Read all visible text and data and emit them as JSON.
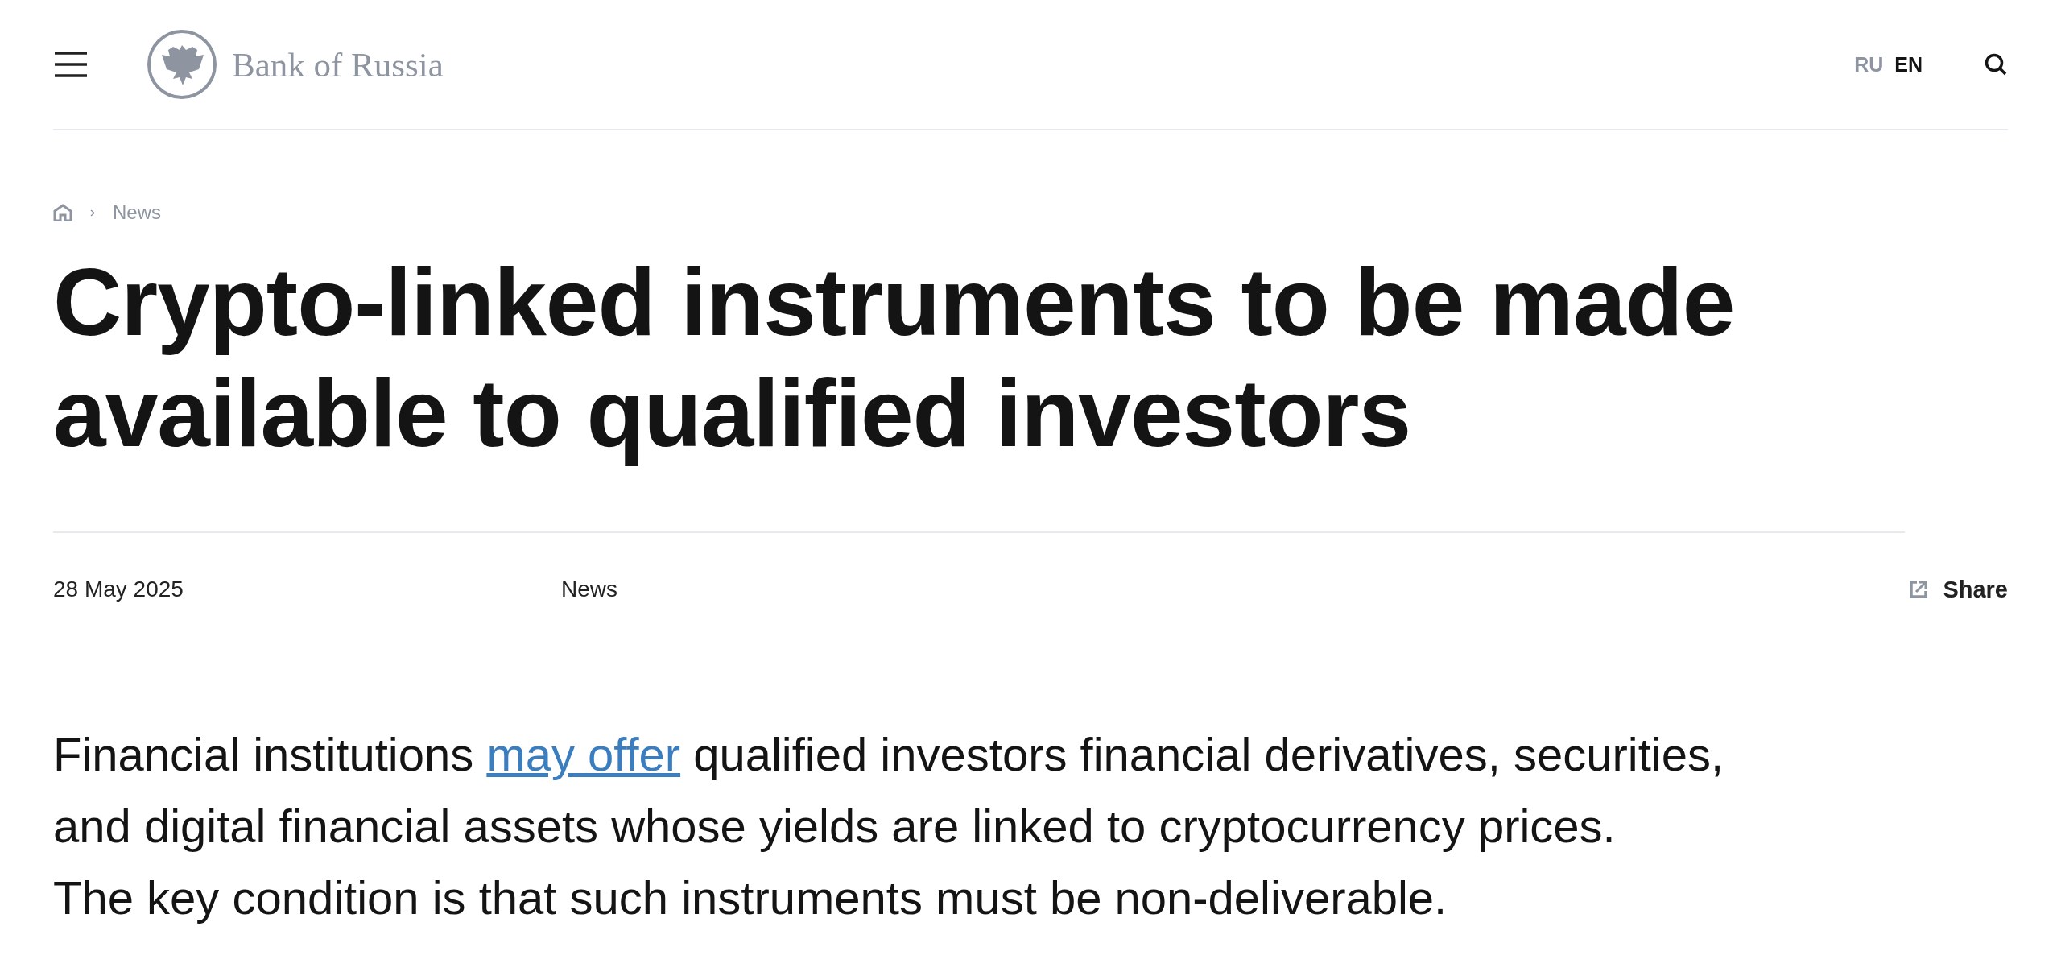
{
  "header": {
    "logo_text": "Bank of Russia",
    "languages": [
      {
        "label": "RU",
        "selected": false
      },
      {
        "label": "EN",
        "selected": true
      }
    ]
  },
  "breadcrumb": [
    {
      "label": "News"
    }
  ],
  "title": "Crypto-linked instruments to be made available to qualified investors",
  "meta": {
    "date": "28 May 2025",
    "category": "News",
    "share": "Share"
  },
  "lead": [
    {
      "before": "Financial institutions ",
      "link": "may offer",
      "after": " qualified investors financial derivatives, securities, and digital financial assets whose yields are linked to cryptocurrency prices."
    },
    {
      "before": "The key condition is that such instruments must be non-deliverable."
    }
  ]
}
